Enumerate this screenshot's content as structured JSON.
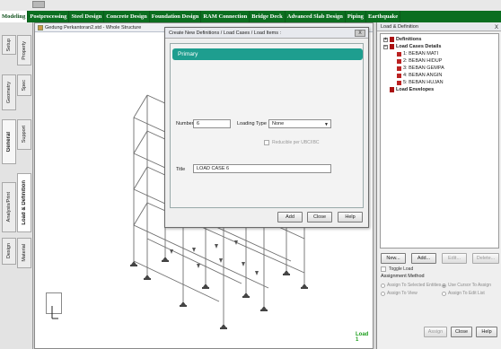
{
  "ribbon": {
    "tabs": [
      "Modeling",
      "Postprocessing",
      "Steel Design",
      "Concrete Design",
      "Foundation Design",
      "RAM Connection",
      "Bridge Deck",
      "Advanced Slab Design",
      "Piping",
      "Earthquake"
    ],
    "active": "Modeling"
  },
  "side_tabs": [
    "Setup",
    "Property",
    "Geometry",
    "Spec",
    "General",
    "Support",
    "Analysis/Print",
    "Load & Definition",
    "Design",
    "Material"
  ],
  "viewport": {
    "title": "Gedung Perkantoran2.std - Whole Structure",
    "load_tag": "Load 1"
  },
  "dialog": {
    "title": "Create New Definitions / Load Cases / Load Items :",
    "close": "X",
    "tab": "Primary",
    "number_label": "Number",
    "number_value": "6",
    "loading_type_label": "Loading Type",
    "loading_type_value": "None",
    "reducible_label": "Reducible per UBC/IBC",
    "title_label": "Title",
    "title_value": "LOAD CASE 6",
    "buttons": {
      "add": "Add",
      "close": "Close",
      "help": "Help"
    }
  },
  "right_panel": {
    "title": "Load & Definition",
    "close": "X",
    "tree": {
      "definitions": "Definitions",
      "load_cases": "Load Cases Details",
      "cases": [
        "1: BEBAN MATI",
        "2: BEBAN HIDUP",
        "3: BEBAN GEMPA",
        "4: BEBAN ANGIN",
        "5: BEBAN HUJAN"
      ],
      "envelopes": "Load Envelopes"
    },
    "buttons": {
      "new": "New...",
      "add": "Add...",
      "edit": "Edit...",
      "delete": "Delete..."
    },
    "toggle_load": "Toggle Load",
    "assignment_method": "Assignment Method",
    "radios": {
      "assign_selected": "Assign To Selected Entities",
      "use_cursor": "Use Cursor To Assign",
      "assign_view": "Assign To View",
      "assign_edit_list": "Assign To Edit List"
    },
    "bottom_buttons": {
      "assign": "Assign",
      "close": "Close",
      "help": "Help"
    }
  }
}
